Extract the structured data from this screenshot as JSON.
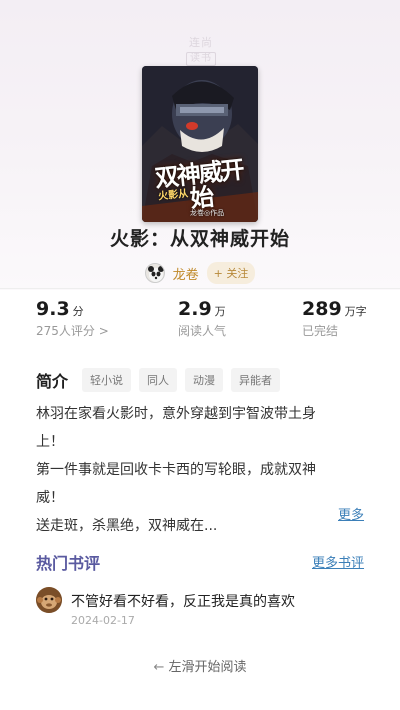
{
  "watermark": {
    "line1": "连尚",
    "line2": "读书"
  },
  "cover": {
    "title_text": "双神威开始",
    "sub_text": "火影从",
    "author_text": "龙卷◎作品"
  },
  "book": {
    "title": "火影：从双神威开始"
  },
  "author": {
    "name": "龙卷",
    "follow_label": "+ 关注"
  },
  "stats": {
    "rating": {
      "value": "9.3",
      "unit": "分",
      "label": "275人评分 >"
    },
    "reads": {
      "value": "2.9",
      "unit": "万",
      "label": "阅读人气"
    },
    "words": {
      "value": "289",
      "unit": "万字",
      "label": "已完结"
    }
  },
  "intro": {
    "title": "简介",
    "tags": [
      "轻小说",
      "同人",
      "动漫",
      "异能者"
    ],
    "lines": [
      "林羽在家看火影时，意外穿越到宇智波带土身",
      "上！",
      "第一件事就是回收卡卡西的写轮眼，成就双神",
      "威！",
      "送走斑，杀黑绝，双神威在..."
    ],
    "more_label": "更多"
  },
  "reviews": {
    "title": "热门书评",
    "more_label": "更多书评",
    "items": [
      {
        "text": "不管好看不好看，反正我是真的喜欢",
        "date": "2024-02-17"
      }
    ]
  },
  "footer": {
    "swipe_label": "左滑开始阅读",
    "arrow": "←"
  }
}
